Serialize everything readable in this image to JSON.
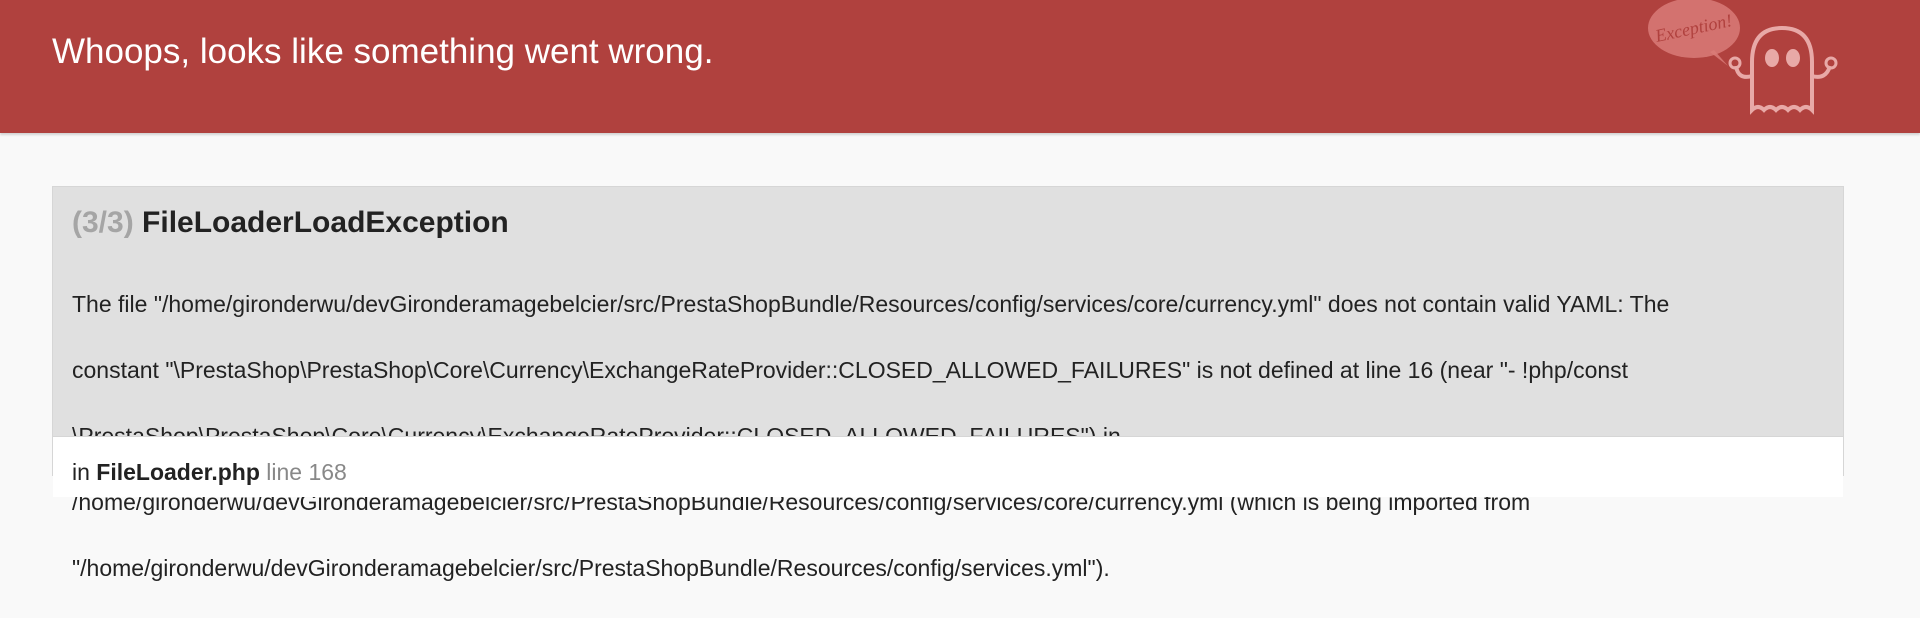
{
  "header": {
    "title": "Whoops, looks like something went wrong.",
    "mascot_bubble_text": "Exception!",
    "background_color": "#b0413e"
  },
  "exception": {
    "count": "(3/3)",
    "name": "FileLoaderLoadException",
    "message_lines": [
      "The file \"/home/gironderwu/devGironderamagebelcier/src/PrestaShopBundle/Resources/config/services/core/currency.yml\" does not contain valid YAML: The",
      "constant \"\\PrestaShop\\PrestaShop\\Core\\Currency\\ExchangeRateProvider::CLOSED_ALLOWED_FAILURES\" is not defined at line 16 (near \"- !php/const",
      "\\PrestaShop\\PrestaShop\\Core\\Currency\\ExchangeRateProvider::CLOSED_ALLOWED_FAILURES\") in",
      "/home/gironderwu/devGironderamagebelcier/src/PrestaShopBundle/Resources/config/services/core/currency.yml (which is being imported from",
      "\"/home/gironderwu/devGironderamagebelcier/src/PrestaShopBundle/Resources/config/services.yml\")."
    ]
  },
  "trace": {
    "first_entry": {
      "prefix": "in",
      "file": "FileLoader.php",
      "line_label": "line 168"
    }
  }
}
